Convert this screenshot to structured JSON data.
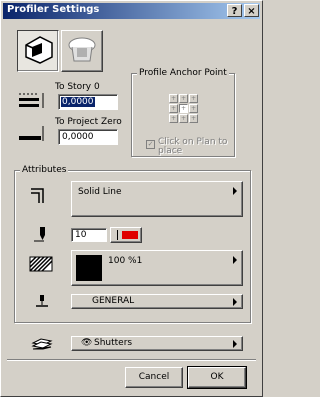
{
  "window": {
    "title": "Profiler Settings",
    "help_label": "?",
    "close_label": "×"
  },
  "levels": {
    "to_story_label": "To Story 0",
    "to_story_value": "0,0000",
    "to_project_zero_label": "To Project Zero",
    "to_project_zero_value": "0,0000"
  },
  "anchor": {
    "title": "Profile Anchor Point",
    "click_on_plan_label": "Click on Plan to place"
  },
  "attributes": {
    "title": "Attributes",
    "line_type": "Solid Line",
    "pen_number": "10",
    "pen_color": "#e00000",
    "fill_name": "100 %1",
    "layer": "GENERAL",
    "favorite": "Shutters"
  },
  "buttons": {
    "cancel": "Cancel",
    "ok": "OK"
  }
}
